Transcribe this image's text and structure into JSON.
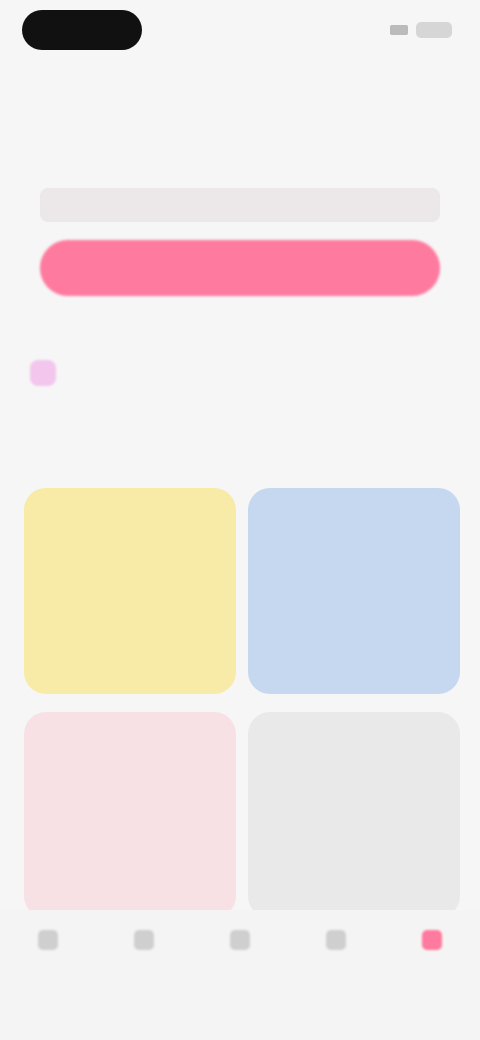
{
  "header": {
    "title": ""
  },
  "summary": {
    "label": "",
    "cta_label": ""
  },
  "info": {
    "text": ""
  },
  "section": {
    "title": ""
  },
  "tiles": [
    {
      "line1": "",
      "line2": ""
    },
    {
      "line1": "",
      "line2": ""
    },
    {
      "line1": "",
      "line2": ""
    },
    {
      "line1": "",
      "line2": ""
    }
  ],
  "nav": [
    {
      "label": ""
    },
    {
      "label": ""
    },
    {
      "label": ""
    },
    {
      "label": ""
    },
    {
      "label": ""
    }
  ],
  "colors": {
    "accent": "#ff7a9e",
    "tile_yellow": "#f7eba7",
    "tile_blue": "#c5d8ef",
    "tile_pink": "#f8e1e5",
    "tile_gray": "#e9e9e9"
  }
}
